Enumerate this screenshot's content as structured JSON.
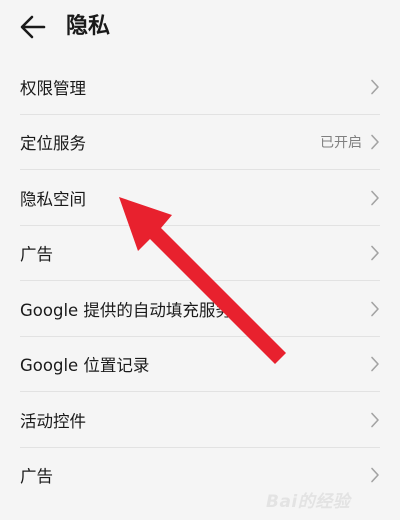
{
  "header": {
    "title": "隐私",
    "back_icon": "back-arrow-icon"
  },
  "settings": [
    {
      "label": "权限管理",
      "value": ""
    },
    {
      "label": "定位服务",
      "value": "已开启"
    },
    {
      "label": "隐私空间",
      "value": ""
    },
    {
      "label": "广告",
      "value": ""
    },
    {
      "label": "Google 提供的自动填充服务",
      "value": ""
    },
    {
      "label": "Google 位置记录",
      "value": ""
    },
    {
      "label": "活动控件",
      "value": ""
    },
    {
      "label": "广告",
      "value": ""
    }
  ],
  "annotation": {
    "arrow_color": "#e8212e"
  },
  "watermark": {
    "text": "Bai的经验",
    "subtext": "经验"
  },
  "colors": {
    "background": "#f5f5f5",
    "text": "#1a1a1a",
    "secondary_text": "#808080",
    "divider": "#e2e2e2"
  }
}
